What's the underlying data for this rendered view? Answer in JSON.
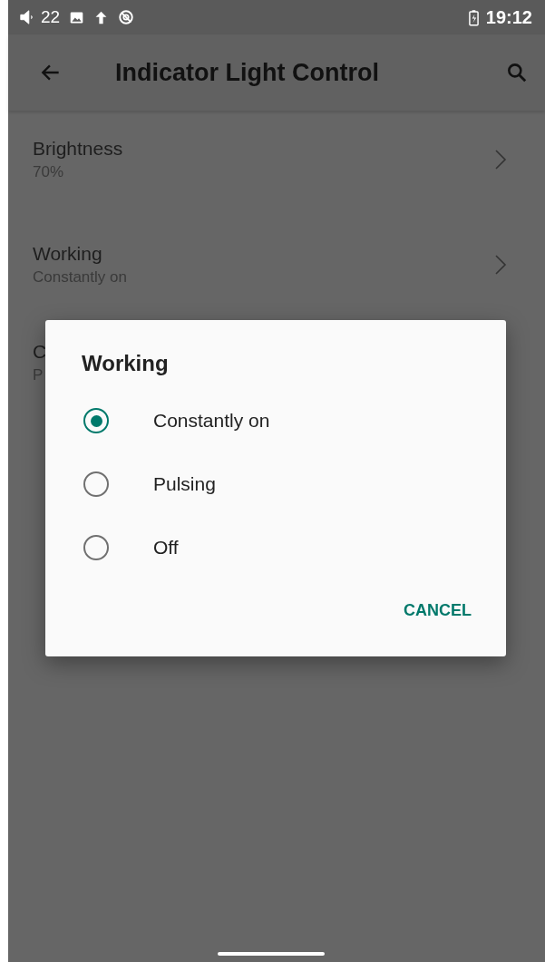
{
  "status_bar": {
    "volume": "22",
    "time": "19:12"
  },
  "app_bar": {
    "title": "Indicator Light Control"
  },
  "settings": [
    {
      "title": "Brightness",
      "summary": "70%"
    },
    {
      "title": "Working",
      "summary": "Constantly on"
    },
    {
      "title": "C",
      "summary": "P"
    }
  ],
  "dialog": {
    "title": "Working",
    "options": [
      {
        "label": "Constantly on",
        "selected": true
      },
      {
        "label": "Pulsing",
        "selected": false
      },
      {
        "label": "Off",
        "selected": false
      }
    ],
    "buttons": [
      "CANCEL"
    ]
  }
}
